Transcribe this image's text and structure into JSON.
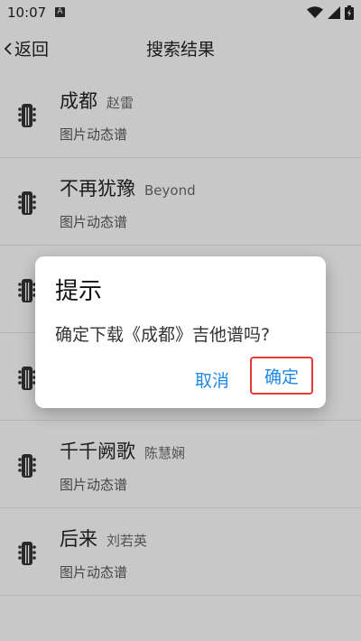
{
  "status": {
    "time": "10:07",
    "notif_letter": "A"
  },
  "nav": {
    "back_label": "返回",
    "title": "搜索结果"
  },
  "list": [
    {
      "title": "成都",
      "artist": "赵雷",
      "sub": "图片动态谱"
    },
    {
      "title": "不再犹豫",
      "artist": "Beyond",
      "sub": "图片动态谱"
    },
    {
      "title": "",
      "artist": "",
      "sub": ""
    },
    {
      "title": "",
      "artist": "",
      "sub": ""
    },
    {
      "title": "千千阙歌",
      "artist": "陈慧娴",
      "sub": "图片动态谱"
    },
    {
      "title": "后来",
      "artist": "刘若英",
      "sub": "图片动态谱"
    }
  ],
  "dialog": {
    "title": "提示",
    "message": "确定下载《成都》吉他谱吗?",
    "cancel": "取消",
    "confirm": "确定"
  },
  "colors": {
    "accent": "#1e88e5",
    "highlight": "#e53935"
  },
  "icons": {
    "list_item": "guitar-icon",
    "status": [
      "wifi-icon",
      "signal-icon",
      "battery-icon"
    ]
  }
}
